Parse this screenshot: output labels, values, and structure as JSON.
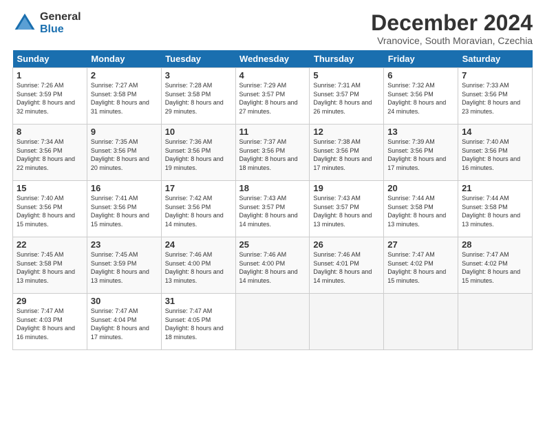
{
  "logo": {
    "general": "General",
    "blue": "Blue"
  },
  "title": "December 2024",
  "location": "Vranovice, South Moravian, Czechia",
  "days_header": [
    "Sunday",
    "Monday",
    "Tuesday",
    "Wednesday",
    "Thursday",
    "Friday",
    "Saturday"
  ],
  "weeks": [
    [
      {
        "num": "1",
        "sunrise": "7:26 AM",
        "sunset": "3:59 PM",
        "daylight": "8 hours and 32 minutes."
      },
      {
        "num": "2",
        "sunrise": "7:27 AM",
        "sunset": "3:58 PM",
        "daylight": "8 hours and 31 minutes."
      },
      {
        "num": "3",
        "sunrise": "7:28 AM",
        "sunset": "3:58 PM",
        "daylight": "8 hours and 29 minutes."
      },
      {
        "num": "4",
        "sunrise": "7:29 AM",
        "sunset": "3:57 PM",
        "daylight": "8 hours and 27 minutes."
      },
      {
        "num": "5",
        "sunrise": "7:31 AM",
        "sunset": "3:57 PM",
        "daylight": "8 hours and 26 minutes."
      },
      {
        "num": "6",
        "sunrise": "7:32 AM",
        "sunset": "3:56 PM",
        "daylight": "8 hours and 24 minutes."
      },
      {
        "num": "7",
        "sunrise": "7:33 AM",
        "sunset": "3:56 PM",
        "daylight": "8 hours and 23 minutes."
      }
    ],
    [
      {
        "num": "8",
        "sunrise": "7:34 AM",
        "sunset": "3:56 PM",
        "daylight": "8 hours and 22 minutes."
      },
      {
        "num": "9",
        "sunrise": "7:35 AM",
        "sunset": "3:56 PM",
        "daylight": "8 hours and 20 minutes."
      },
      {
        "num": "10",
        "sunrise": "7:36 AM",
        "sunset": "3:56 PM",
        "daylight": "8 hours and 19 minutes."
      },
      {
        "num": "11",
        "sunrise": "7:37 AM",
        "sunset": "3:56 PM",
        "daylight": "8 hours and 18 minutes."
      },
      {
        "num": "12",
        "sunrise": "7:38 AM",
        "sunset": "3:56 PM",
        "daylight": "8 hours and 17 minutes."
      },
      {
        "num": "13",
        "sunrise": "7:39 AM",
        "sunset": "3:56 PM",
        "daylight": "8 hours and 17 minutes."
      },
      {
        "num": "14",
        "sunrise": "7:40 AM",
        "sunset": "3:56 PM",
        "daylight": "8 hours and 16 minutes."
      }
    ],
    [
      {
        "num": "15",
        "sunrise": "7:40 AM",
        "sunset": "3:56 PM",
        "daylight": "8 hours and 15 minutes."
      },
      {
        "num": "16",
        "sunrise": "7:41 AM",
        "sunset": "3:56 PM",
        "daylight": "8 hours and 15 minutes."
      },
      {
        "num": "17",
        "sunrise": "7:42 AM",
        "sunset": "3:56 PM",
        "daylight": "8 hours and 14 minutes."
      },
      {
        "num": "18",
        "sunrise": "7:43 AM",
        "sunset": "3:57 PM",
        "daylight": "8 hours and 14 minutes."
      },
      {
        "num": "19",
        "sunrise": "7:43 AM",
        "sunset": "3:57 PM",
        "daylight": "8 hours and 13 minutes."
      },
      {
        "num": "20",
        "sunrise": "7:44 AM",
        "sunset": "3:58 PM",
        "daylight": "8 hours and 13 minutes."
      },
      {
        "num": "21",
        "sunrise": "7:44 AM",
        "sunset": "3:58 PM",
        "daylight": "8 hours and 13 minutes."
      }
    ],
    [
      {
        "num": "22",
        "sunrise": "7:45 AM",
        "sunset": "3:58 PM",
        "daylight": "8 hours and 13 minutes."
      },
      {
        "num": "23",
        "sunrise": "7:45 AM",
        "sunset": "3:59 PM",
        "daylight": "8 hours and 13 minutes."
      },
      {
        "num": "24",
        "sunrise": "7:46 AM",
        "sunset": "4:00 PM",
        "daylight": "8 hours and 13 minutes."
      },
      {
        "num": "25",
        "sunrise": "7:46 AM",
        "sunset": "4:00 PM",
        "daylight": "8 hours and 14 minutes."
      },
      {
        "num": "26",
        "sunrise": "7:46 AM",
        "sunset": "4:01 PM",
        "daylight": "8 hours and 14 minutes."
      },
      {
        "num": "27",
        "sunrise": "7:47 AM",
        "sunset": "4:02 PM",
        "daylight": "8 hours and 15 minutes."
      },
      {
        "num": "28",
        "sunrise": "7:47 AM",
        "sunset": "4:02 PM",
        "daylight": "8 hours and 15 minutes."
      }
    ],
    [
      {
        "num": "29",
        "sunrise": "7:47 AM",
        "sunset": "4:03 PM",
        "daylight": "8 hours and 16 minutes."
      },
      {
        "num": "30",
        "sunrise": "7:47 AM",
        "sunset": "4:04 PM",
        "daylight": "8 hours and 17 minutes."
      },
      {
        "num": "31",
        "sunrise": "7:47 AM",
        "sunset": "4:05 PM",
        "daylight": "8 hours and 18 minutes."
      },
      null,
      null,
      null,
      null
    ]
  ]
}
